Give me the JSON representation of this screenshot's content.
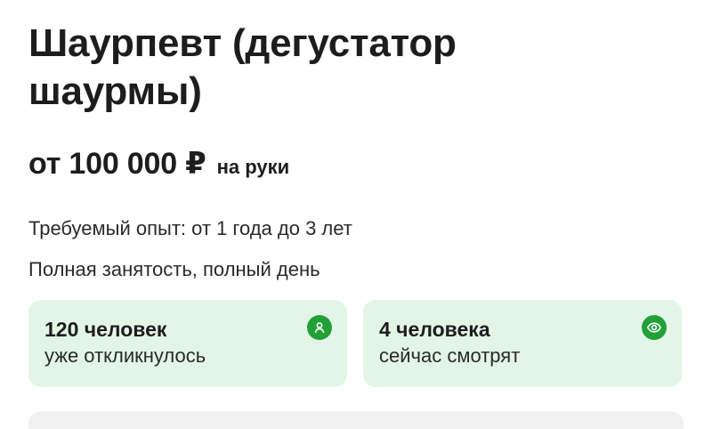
{
  "vacancy": {
    "title": "Шаурпевт (дегустатор шаурмы)",
    "salary_amount": "от 100 000 ₽",
    "salary_note": "на руки",
    "experience": "Требуемый опыт: от 1 года до 3 лет",
    "employment": "Полная занятость, полный день"
  },
  "stats": [
    {
      "count": "120 человек",
      "caption": "уже откликнулось",
      "icon": "person-icon"
    },
    {
      "count": "4 человека",
      "caption": "сейчас смотрят",
      "icon": "eye-icon"
    }
  ],
  "colors": {
    "card_background": "#e3f5e7",
    "accent_green": "#21a038"
  }
}
